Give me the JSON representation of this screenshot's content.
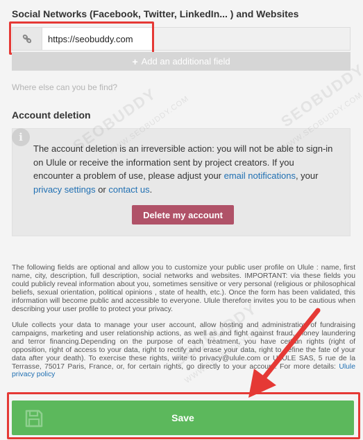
{
  "social": {
    "title": "Social Networks (Facebook, Twitter, LinkedIn... ) and Websites",
    "url_value": "https://seobuddy.com",
    "add_field_label": "Add an additional field",
    "help_text": "Where else can you be find?"
  },
  "account_deletion": {
    "title": "Account deletion",
    "text_1": "The account deletion is an irreversible action: you will not be able to sign-in on Ulule or receive the information sent by project creators. If you encounter a problem of use, please adjust your ",
    "link_email": "email notifications",
    "text_2": ", your ",
    "link_privacy": "privacy settings",
    "text_3": " or ",
    "link_contact": "contact us",
    "text_4": ".",
    "delete_button": "Delete my account"
  },
  "legal": {
    "para_1": "The following fields are optional and allow you to customize your public user profile on Ulule : name, first name, city, description, full description, social networks and websites. IMPORTANT: via these fields you could publicly reveal information about you, sometimes sensitive or very personal (religious or philosophical beliefs, sexual orientation, political opinions , state of health, etc.). Once the form has been validated, this information will become public and accessible to everyone. Ulule therefore invites you to be cautious when describing your user profile to protect your privacy.",
    "para_2": "Ulule collects your data to manage your user account, allow hosting and administration of fundraising campaigns, marketing and user relationship actions, as well as and fight against fraud, money laundering and terror financing.Depending on the purpose of each treatment, you have certain rights (right of opposition, right of access to your data, right to rectify and erase your data, right to define the fate of your data after your death). To exercise these rights, write to privacy@ulule.com or ULULE SAS, 5 rue de la Terrasse, 75017 Paris, France, or, for certain rights, go directly to your account. For more details: ",
    "privacy_link": "Ulule privacy policy"
  },
  "save": {
    "label": "Save"
  },
  "watermark": {
    "text": "SEOBUDDY",
    "small_text": "WWW.SEOBUDDY.COM"
  },
  "colors": {
    "highlight": "#e53935",
    "save_green": "#5cb85c",
    "delete_button": "#b05268",
    "link": "#1f6fb2"
  },
  "icons": {
    "url": "link-icon",
    "add": "plus-icon",
    "info": "info-icon",
    "save": "save-icon"
  }
}
